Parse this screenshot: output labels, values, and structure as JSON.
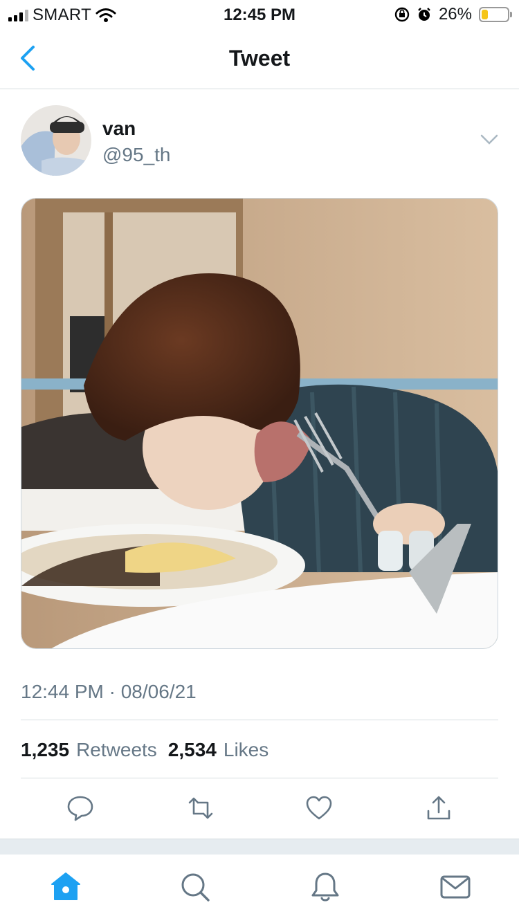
{
  "status_bar": {
    "carrier": "SMART",
    "time": "12:45 PM",
    "battery_percent": "26%",
    "battery_level": 0.26,
    "icons": [
      "signal-icon",
      "wifi-icon",
      "orientation-lock-icon",
      "alarm-icon",
      "battery-icon"
    ]
  },
  "nav": {
    "title": "Tweet",
    "back_icon": "chevron-left-icon"
  },
  "tweet": {
    "author_name": "van",
    "author_handle": "@95_th",
    "timestamp": "12:44 PM · 08/06/21",
    "retweets_count": "1,235",
    "retweets_label": "Retweets",
    "likes_count": "2,534",
    "likes_label": "Likes"
  },
  "actions": [
    "reply-icon",
    "retweet-icon",
    "like-icon",
    "share-icon"
  ],
  "tabbar": [
    "home-icon",
    "search-icon",
    "notifications-icon",
    "messages-icon"
  ],
  "colors": {
    "accent": "#1da1f2",
    "secondary_text": "#657786",
    "divider": "#d5dce0"
  }
}
